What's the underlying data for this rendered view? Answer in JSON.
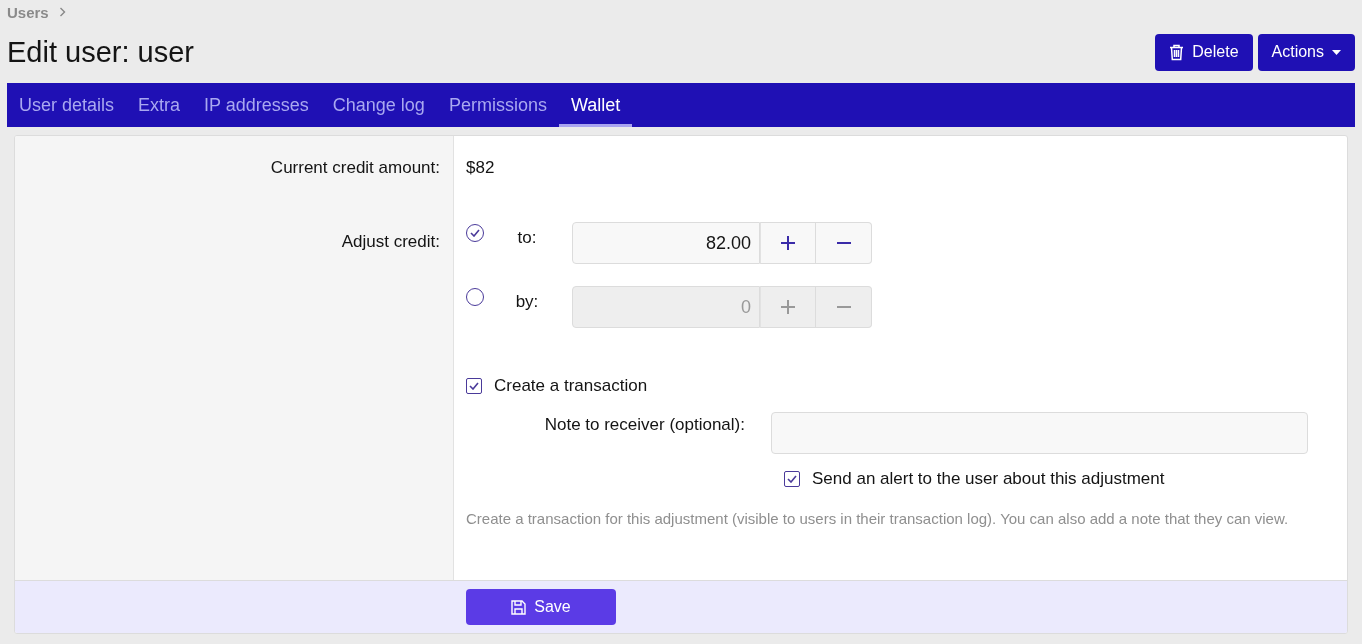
{
  "breadcrumb": {
    "label": "Users"
  },
  "title": "Edit user: user",
  "header_buttons": [
    {
      "kind": "delete",
      "label": "Delete"
    },
    {
      "kind": "menu",
      "label": "Actions"
    }
  ],
  "tabs": [
    {
      "label": "User details",
      "selected": false
    },
    {
      "label": "Extra",
      "selected": false
    },
    {
      "label": "IP addresses",
      "selected": false
    },
    {
      "label": "Change log",
      "selected": false
    },
    {
      "label": "Permissions",
      "selected": false
    },
    {
      "label": "Wallet",
      "selected": true
    }
  ],
  "current_credit": {
    "label": "Current credit amount:",
    "value": "$82"
  },
  "adjust_credit": {
    "label": "Adjust credit:",
    "options": [
      {
        "label": "to:",
        "selected": true,
        "value": "82.00",
        "disabled": false
      },
      {
        "label": "by:",
        "selected": false,
        "value": "0",
        "disabled": true
      }
    ]
  },
  "transaction": {
    "label": "Create a transaction",
    "checked": true
  },
  "note": {
    "label": "Note to receiver (optional):"
  },
  "alert": {
    "label": "Send an alert to the user about this adjustment",
    "checked": true
  },
  "hint": "Create a transaction for this adjustment (visible to users in their transaction log). You can also add a note that they can view.",
  "save_button": {
    "label": "Save"
  }
}
